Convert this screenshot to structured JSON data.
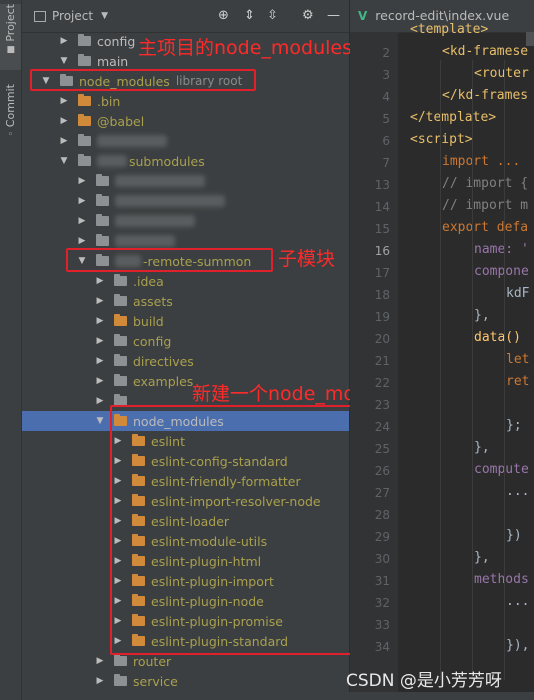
{
  "sidebar": {
    "project_tab": "Project",
    "commit_tab": "Commit"
  },
  "panel": {
    "title": "Project"
  },
  "tree": [
    {
      "label": "config",
      "depth": 1,
      "icon": "gray",
      "arrow": "collapsed",
      "color": "white"
    },
    {
      "label": "main",
      "depth": 1,
      "icon": "gray",
      "arrow": "expanded",
      "color": "white"
    },
    {
      "label": "node_modules",
      "hint": "library root",
      "depth": 0,
      "icon": "gray",
      "arrow": "expanded",
      "color": "olive"
    },
    {
      "label": ".bin",
      "depth": 1,
      "icon": "orange",
      "arrow": "collapsed",
      "color": "olive"
    },
    {
      "label": "@babel",
      "depth": 1,
      "icon": "orange",
      "arrow": "collapsed",
      "color": "olive"
    },
    {
      "label": "",
      "depth": 1,
      "icon": "gray",
      "arrow": "collapsed",
      "blur": 70
    },
    {
      "label": "submodules",
      "depth": 1,
      "icon": "gray",
      "arrow": "expanded",
      "color": "olive",
      "blur_prefix": 30
    },
    {
      "label": "",
      "depth": 2,
      "icon": "gray",
      "arrow": "collapsed",
      "blur": 90
    },
    {
      "label": "",
      "depth": 2,
      "icon": "gray",
      "arrow": "collapsed",
      "blur": 110
    },
    {
      "label": "",
      "depth": 2,
      "icon": "gray",
      "arrow": "collapsed",
      "blur": 80
    },
    {
      "label": "",
      "depth": 2,
      "icon": "gray",
      "arrow": "collapsed",
      "blur": 60
    },
    {
      "label": "-remote-summon",
      "depth": 2,
      "icon": "gray",
      "arrow": "expanded",
      "color": "olive",
      "blur_prefix": 26
    },
    {
      "label": ".idea",
      "depth": 3,
      "icon": "gray",
      "arrow": "collapsed",
      "color": "olive"
    },
    {
      "label": "assets",
      "depth": 3,
      "icon": "gray",
      "arrow": "collapsed",
      "color": "olive"
    },
    {
      "label": "build",
      "depth": 3,
      "icon": "orange",
      "arrow": "collapsed",
      "color": "olive"
    },
    {
      "label": "config",
      "depth": 3,
      "icon": "gray",
      "arrow": "collapsed",
      "color": "olive"
    },
    {
      "label": "directives",
      "depth": 3,
      "icon": "gray",
      "arrow": "collapsed",
      "color": "olive"
    },
    {
      "label": "examples",
      "depth": 3,
      "icon": "gray",
      "arrow": "collapsed",
      "color": "olive"
    },
    {
      "label": "",
      "depth": 3,
      "icon": "gray",
      "arrow": "collapsed",
      "blur": 0
    },
    {
      "label": "node_modules",
      "depth": 3,
      "icon": "orange",
      "arrow": "expanded",
      "color": "white",
      "selected": true
    },
    {
      "label": "eslint",
      "depth": 4,
      "icon": "orange",
      "arrow": "collapsed",
      "color": "olive"
    },
    {
      "label": "eslint-config-standard",
      "depth": 4,
      "icon": "orange",
      "arrow": "collapsed",
      "color": "olive"
    },
    {
      "label": "eslint-friendly-formatter",
      "depth": 4,
      "icon": "orange",
      "arrow": "collapsed",
      "color": "olive"
    },
    {
      "label": "eslint-import-resolver-node",
      "depth": 4,
      "icon": "orange",
      "arrow": "collapsed",
      "color": "olive"
    },
    {
      "label": "eslint-loader",
      "depth": 4,
      "icon": "orange",
      "arrow": "collapsed",
      "color": "olive"
    },
    {
      "label": "eslint-module-utils",
      "depth": 4,
      "icon": "orange",
      "arrow": "collapsed",
      "color": "olive"
    },
    {
      "label": "eslint-plugin-html",
      "depth": 4,
      "icon": "orange",
      "arrow": "collapsed",
      "color": "olive"
    },
    {
      "label": "eslint-plugin-import",
      "depth": 4,
      "icon": "orange",
      "arrow": "collapsed",
      "color": "olive"
    },
    {
      "label": "eslint-plugin-node",
      "depth": 4,
      "icon": "orange",
      "arrow": "collapsed",
      "color": "olive"
    },
    {
      "label": "eslint-plugin-promise",
      "depth": 4,
      "icon": "orange",
      "arrow": "collapsed",
      "color": "olive"
    },
    {
      "label": "eslint-plugin-standard",
      "depth": 4,
      "icon": "orange",
      "arrow": "collapsed",
      "color": "olive"
    },
    {
      "label": "router",
      "depth": 3,
      "icon": "gray",
      "arrow": "collapsed",
      "color": "olive"
    },
    {
      "label": "service",
      "depth": 3,
      "icon": "gray",
      "arrow": "collapsed",
      "color": "olive"
    }
  ],
  "annotations": {
    "main_node_modules": "主项目的node_modules",
    "submodule": "子模块",
    "new_node_modules": "新建一个node_modules"
  },
  "editor": {
    "tab_name": "record-edit\\index.vue",
    "lines": [
      {
        "n": "",
        "text": "<template>",
        "cls": "k-tag",
        "indent": 0
      },
      {
        "n": "2",
        "text": "<kd-framese",
        "cls": "k-tag",
        "indent": 1
      },
      {
        "n": "3",
        "text": "<router",
        "cls": "k-tag",
        "indent": 2
      },
      {
        "n": "4",
        "text": "</kd-frames",
        "cls": "k-tag",
        "indent": 1
      },
      {
        "n": "5",
        "text": "</template>",
        "cls": "k-tag",
        "indent": 0
      },
      {
        "n": "6",
        "text": "<script>",
        "cls": "k-tag",
        "indent": 0
      },
      {
        "n": "7",
        "text": "import ...",
        "cls": "k-kw",
        "indent": 1
      },
      {
        "n": "13",
        "text": "// import {",
        "cls": "k-cm",
        "indent": 1
      },
      {
        "n": "14",
        "text": "// import m",
        "cls": "k-cm",
        "indent": 1
      },
      {
        "n": "15",
        "text": "export defa",
        "cls": "k-kw",
        "indent": 1
      },
      {
        "n": "16",
        "text": "name: '",
        "cls": "k-prop",
        "indent": 2
      },
      {
        "n": "17",
        "text": "compone",
        "cls": "k-prop",
        "indent": 2
      },
      {
        "n": "18",
        "text": "kdF",
        "cls": "k-pl",
        "indent": 3
      },
      {
        "n": "19",
        "text": "},",
        "cls": "k-pl",
        "indent": 2
      },
      {
        "n": "20",
        "text": "data()",
        "cls": "k-fn",
        "indent": 2
      },
      {
        "n": "21",
        "text": "let",
        "cls": "k-kw",
        "indent": 3
      },
      {
        "n": "22",
        "text": "ret",
        "cls": "k-kw",
        "indent": 3
      },
      {
        "n": "23",
        "text": "",
        "cls": "k-pl",
        "indent": 3
      },
      {
        "n": "24",
        "text": "};",
        "cls": "k-pl",
        "indent": 3
      },
      {
        "n": "25",
        "text": "},",
        "cls": "k-pl",
        "indent": 2
      },
      {
        "n": "26",
        "text": "compute",
        "cls": "k-prop",
        "indent": 2
      },
      {
        "n": "27",
        "text": "...",
        "cls": "k-pl",
        "indent": 3
      },
      {
        "n": "28",
        "text": "",
        "cls": "k-pl",
        "indent": 3
      },
      {
        "n": "29",
        "text": "})",
        "cls": "k-pl",
        "indent": 3
      },
      {
        "n": "30",
        "text": "},",
        "cls": "k-pl",
        "indent": 2
      },
      {
        "n": "31",
        "text": "methods",
        "cls": "k-prop",
        "indent": 2
      },
      {
        "n": "32",
        "text": "...",
        "cls": "k-pl",
        "indent": 3
      },
      {
        "n": "33",
        "text": "",
        "cls": "k-pl",
        "indent": 3
      },
      {
        "n": "34",
        "text": "}),",
        "cls": "k-pl",
        "indent": 3
      }
    ]
  },
  "watermark": "CSDN @是小芳芳呀"
}
